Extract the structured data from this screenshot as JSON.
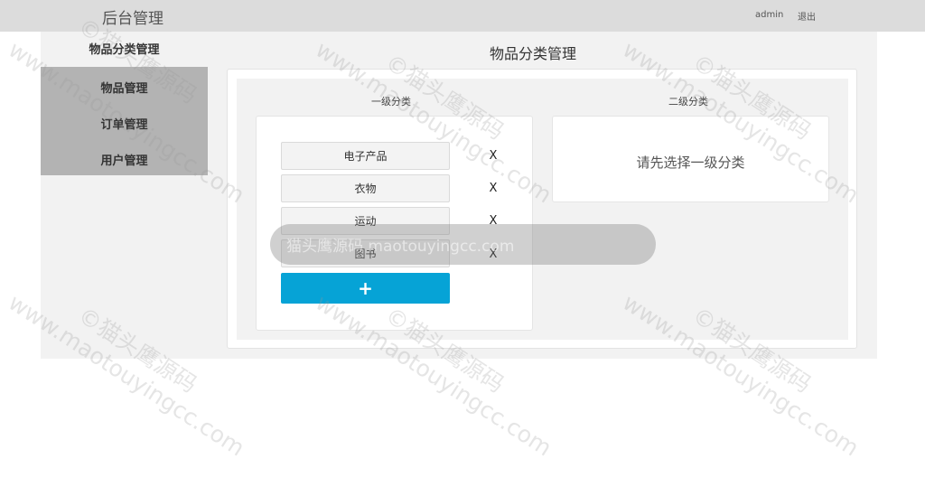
{
  "header": {
    "brand": "后台管理",
    "user": "admin",
    "logout": "退出"
  },
  "sidebar": {
    "heading": "物品分类管理",
    "items": [
      {
        "label": "物品管理"
      },
      {
        "label": "订单管理"
      },
      {
        "label": "用户管理"
      }
    ]
  },
  "main": {
    "title": "物品分类管理",
    "level1": {
      "label": "一级分类",
      "categories": [
        "电子产品",
        "衣物",
        "运动",
        "图书"
      ],
      "delete_label": "X",
      "add_label": "+"
    },
    "level2": {
      "label": "二级分类",
      "hint": "请先选择一级分类"
    }
  },
  "watermark": {
    "url": "www.maotouyingcc.com",
    "brand": "©猫头鹰源码",
    "banner": "猫头鹰源码 maotouyingcc.com"
  },
  "colors": {
    "topbar": "#dcdcdc",
    "sidebar_menu": "#b3b3b3",
    "add_button": "#06a3d6"
  }
}
